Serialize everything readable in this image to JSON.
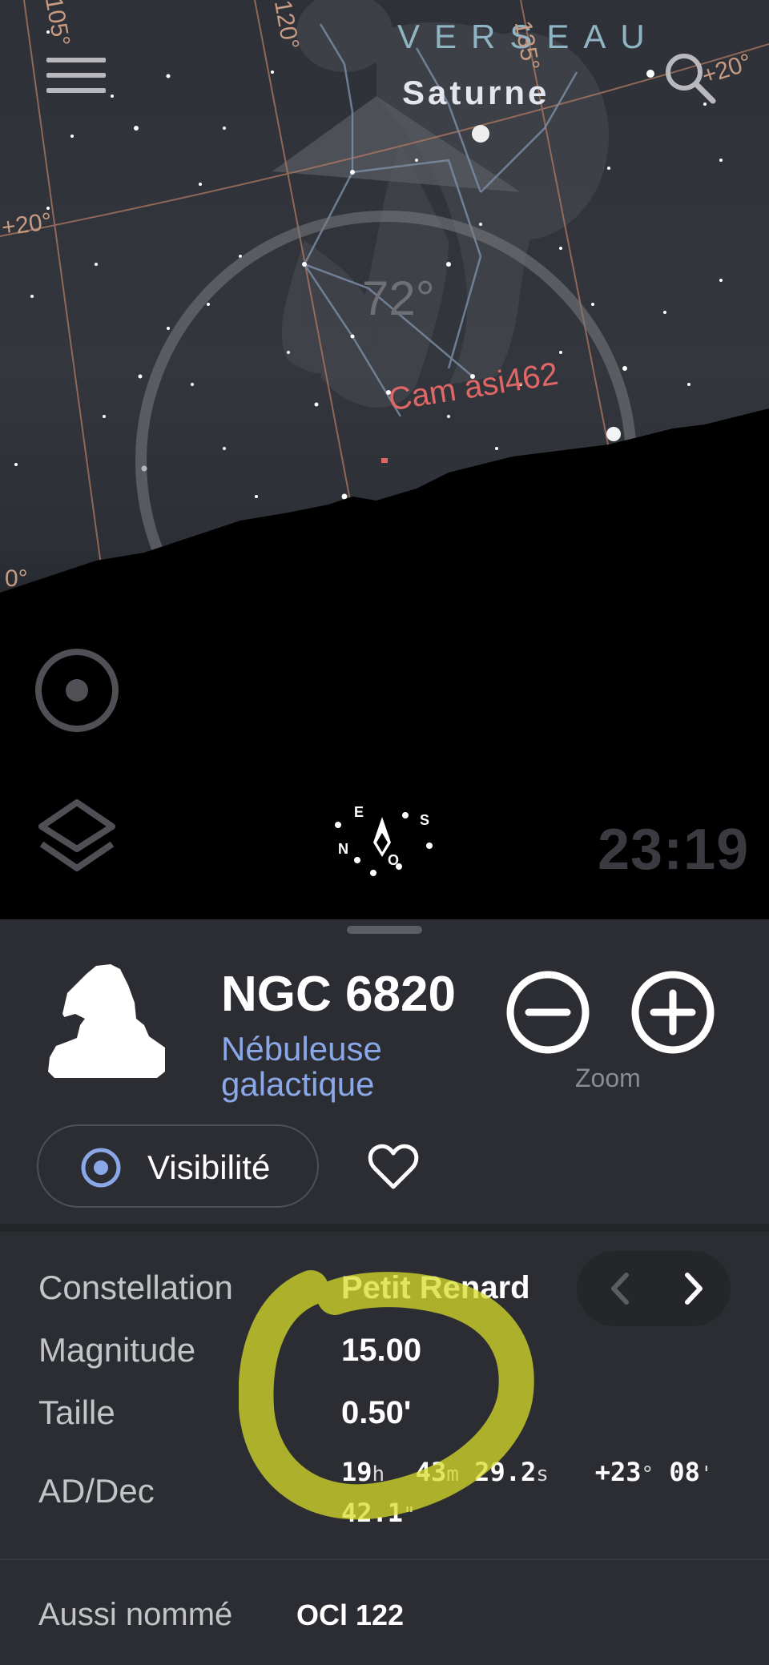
{
  "sky": {
    "constellation": "VERSEAU",
    "planet": "Saturne",
    "altitude": "72°",
    "camera_label": "Cam asi462",
    "grid_labels": [
      "105°",
      "120°",
      "135°",
      "+20°",
      "+20°",
      "0°"
    ],
    "time": "23:19",
    "compass": {
      "east": "E",
      "south": "S",
      "north": "N",
      "west": "O"
    }
  },
  "object": {
    "name": "NGC 6820",
    "type": "Nébuleuse galactique",
    "zoom_label": "Zoom",
    "visibility_label": "Visibilité"
  },
  "details": {
    "constellation_label": "Constellation",
    "constellation_value": "Petit Renard",
    "magnitude_label": "Magnitude",
    "magnitude_value": "15.00",
    "size_label": "Taille",
    "size_value": "0.50'",
    "radec_label": "AD/Dec",
    "ra_h": "19",
    "ra_h_unit": "h",
    "ra_m": "43",
    "ra_m_unit": "m",
    "ra_s": "29.2",
    "ra_s_unit": "s",
    "dec_deg": "+23",
    "dec_deg_unit": "°",
    "dec_min": "08",
    "dec_min_unit": "'",
    "dec_sec": "42.1",
    "dec_sec_unit": "\""
  },
  "aka": {
    "label": "Aussi nommé",
    "value": "OCl 122"
  },
  "colors": {
    "accent": "#8aa7e8",
    "camera": "#e06766",
    "grid": "#c79b82",
    "highlight": "#d8dc2a"
  }
}
